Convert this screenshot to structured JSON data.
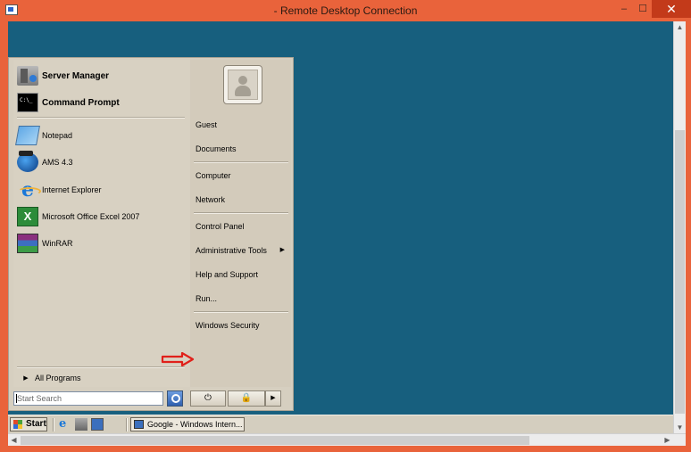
{
  "window": {
    "title": "- Remote Desktop Connection",
    "minimize": "–",
    "restore": "☐",
    "close": "✕"
  },
  "start_menu": {
    "pinned": [
      {
        "label": "Server Manager",
        "icon": "server-manager-icon"
      },
      {
        "label": "Command Prompt",
        "icon": "command-prompt-icon"
      }
    ],
    "recent": [
      {
        "label": "Notepad",
        "icon": "notepad-icon"
      },
      {
        "label": "AMS 4.3",
        "icon": "ams-icon"
      },
      {
        "label": "Internet Explorer",
        "icon": "internet-explorer-icon"
      },
      {
        "label": "Microsoft Office Excel 2007",
        "icon": "excel-icon"
      },
      {
        "label": "WinRAR",
        "icon": "winrar-icon"
      }
    ],
    "all_programs": "All Programs",
    "all_programs_arrow": "▶",
    "right": {
      "guest": "Guest",
      "documents": "Documents",
      "computer": "Computer",
      "network": "Network",
      "control_panel": "Control Panel",
      "admin_tools": "Administrative Tools",
      "help": "Help and Support",
      "run": "Run...",
      "windows_security": "Windows Security",
      "submenu_arrow": "▶"
    },
    "search": {
      "placeholder": "Start Search"
    },
    "power_buttons": {
      "power": "⏻",
      "lock": "🔒",
      "more": "▶"
    }
  },
  "taskbar": {
    "start": "Start",
    "task": "Google - Windows Intern..."
  },
  "scrollbars": {
    "up": "▲",
    "down": "▼",
    "left": "◀",
    "right": "▶"
  },
  "colors": {
    "desktop": "#175f7e",
    "frame": "#e9633b",
    "annotation_arrow": "#e0201a"
  }
}
